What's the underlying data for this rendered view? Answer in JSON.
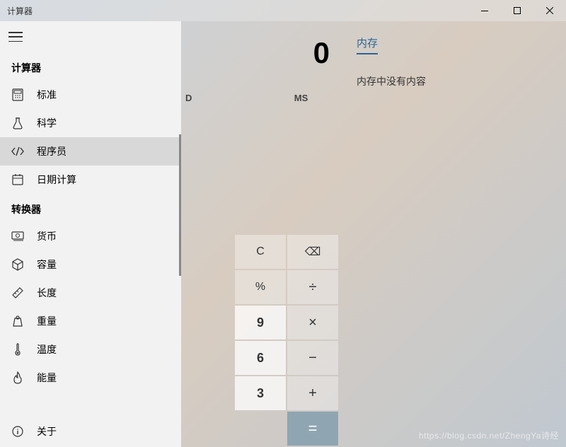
{
  "window": {
    "title": "计算器"
  },
  "sidebar": {
    "section_calculator": "计算器",
    "section_converter": "转换器",
    "items_calc": [
      {
        "label": "标准",
        "icon": "standard"
      },
      {
        "label": "科学",
        "icon": "scientific"
      },
      {
        "label": "程序员",
        "icon": "programmer"
      },
      {
        "label": "日期计算",
        "icon": "date"
      }
    ],
    "items_conv": [
      {
        "label": "货币",
        "icon": "currency"
      },
      {
        "label": "容量",
        "icon": "volume"
      },
      {
        "label": "长度",
        "icon": "length"
      },
      {
        "label": "重量",
        "icon": "weight"
      },
      {
        "label": "温度",
        "icon": "temperature"
      },
      {
        "label": "能量",
        "icon": "energy"
      }
    ],
    "about": "关于"
  },
  "calc": {
    "display_value": "0",
    "partial_label_d": "D",
    "mem_btn_ms": "MS",
    "keys": {
      "c": "C",
      "backspace": "⌫",
      "percent": "%",
      "divide": "÷",
      "nine": "9",
      "multiply": "×",
      "six": "6",
      "minus": "−",
      "three": "3",
      "plus": "+",
      "equals": "="
    }
  },
  "memory": {
    "tab_label": "内存",
    "empty_text": "内存中没有内容"
  },
  "watermark": "https://blog.csdn.net/ZhengYa诗经"
}
